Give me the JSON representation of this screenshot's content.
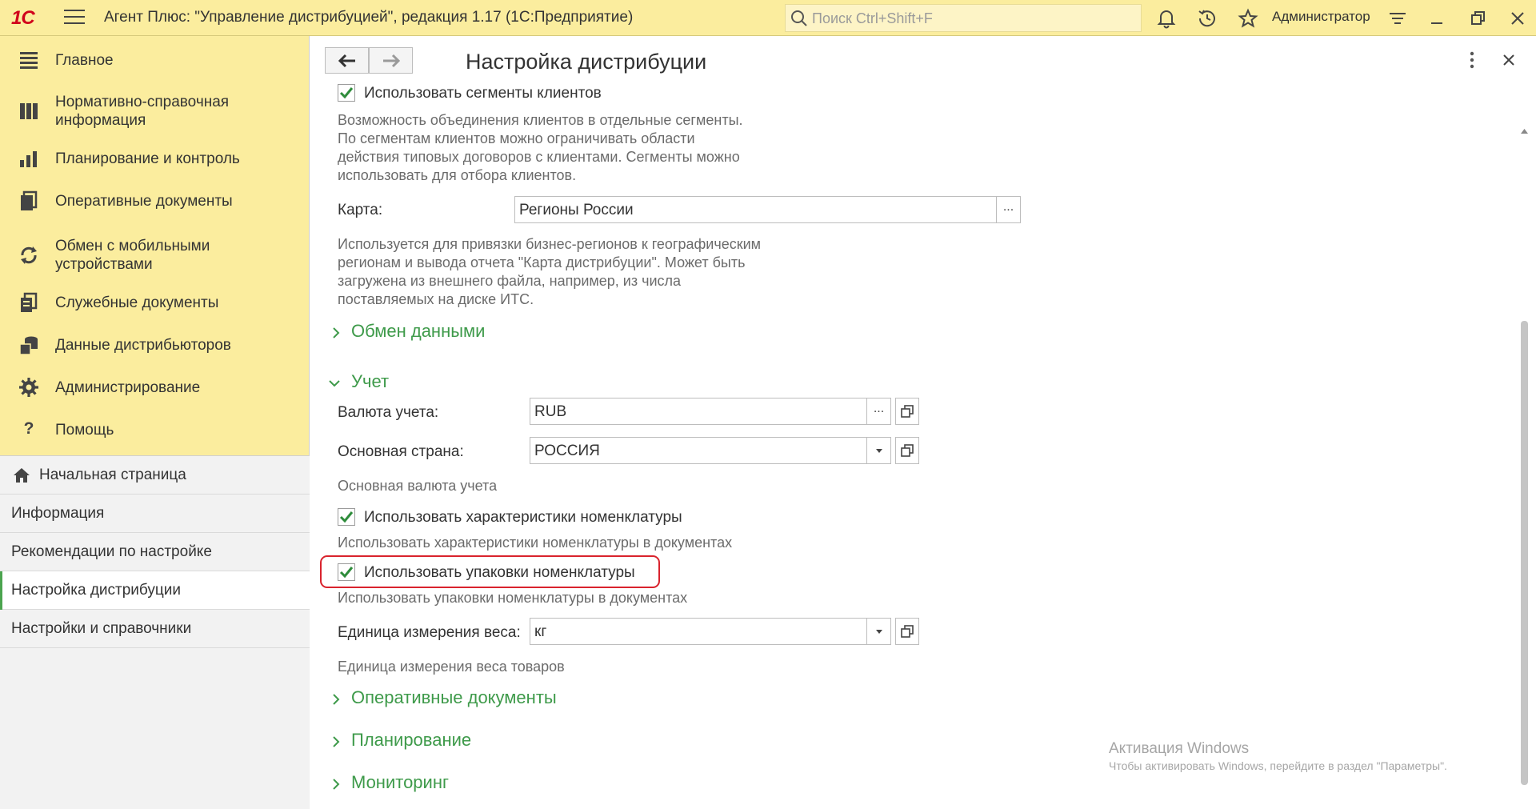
{
  "app": {
    "logo": "1С",
    "title": "Агент Плюс: \"Управление дистрибуцией\", редакция 1.17  (1С:Предприятие)",
    "search_placeholder": "Поиск Ctrl+Shift+F",
    "user": "Администратор"
  },
  "sidebar": {
    "sections": [
      {
        "label": "Главное",
        "icon": "list-icon"
      },
      {
        "label": "Нормативно-справочная информация",
        "icon": "catalog-icon"
      },
      {
        "label": "Планирование и контроль",
        "icon": "bar-chart-icon"
      },
      {
        "label": "Оперативные документы",
        "icon": "documents-icon"
      },
      {
        "label": "Обмен с мобильными устройствами",
        "icon": "sync-icon"
      },
      {
        "label": "Служебные документы",
        "icon": "service-docs-icon"
      },
      {
        "label": "Данные дистрибьюторов",
        "icon": "distributor-data-icon"
      },
      {
        "label": "Администрирование",
        "icon": "gear-icon"
      },
      {
        "label": "Помощь",
        "icon": "help-icon"
      }
    ],
    "open_windows": [
      {
        "label": "Начальная страница",
        "icon": "home-icon"
      },
      {
        "label": "Информация"
      },
      {
        "label": "Рекомендации по настройке"
      },
      {
        "label": "Настройка дистрибуции",
        "active": true
      },
      {
        "label": "Настройки и справочники"
      }
    ]
  },
  "form": {
    "title": "Настройка дистрибуции",
    "segments": {
      "checkbox_label": "Использовать сегменты клиентов",
      "checked": true,
      "note": [
        "Возможность объединения клиентов в отдельные сегменты.",
        "По сегментам клиентов можно ограничивать области",
        "действия типовых договоров с клиентами. Сегменты можно",
        "использовать для отбора клиентов."
      ]
    },
    "map": {
      "label": "Карта:",
      "value": "Регионы России",
      "button": "...",
      "note": [
        "Используется для привязки бизнес-регионов к географическим",
        "регионам и вывода отчета \"Карта дистрибуции\". Может быть",
        "загружена из внешнего файла, например, из числа",
        "поставляемых на диске ИТС."
      ]
    },
    "group_exchange": "Обмен данными",
    "group_accounting": "Учет",
    "currency": {
      "label": "Валюта учета:",
      "value": "RUB",
      "button": "..."
    },
    "country": {
      "label": "Основная страна:",
      "value": "РОССИЯ",
      "note": "Основная валюта учета"
    },
    "characteristics": {
      "checkbox_label": "Использовать характеристики номенклатуры",
      "checked": true,
      "note": "Использовать характеристики номенклатуры в документах"
    },
    "packaging": {
      "checkbox_label": "Использовать упаковки номенклатуры",
      "checked": true,
      "note": "Использовать упаковки номенклатуры в документах"
    },
    "weight_unit": {
      "label": "Единица измерения веса:",
      "value": "кг",
      "note": "Единица измерения веса товаров"
    },
    "group_operational": "Оперативные документы",
    "group_planning": "Планирование",
    "group_monitoring": "Мониторинг"
  },
  "watermark": {
    "line1": "Активация Windows",
    "line2": "Чтобы активировать Windows, перейдите в раздел \"Параметры\"."
  },
  "colors": {
    "accent": "#3e9a4a",
    "header_bg": "#fbed9e",
    "highlight": "#d9232d"
  }
}
